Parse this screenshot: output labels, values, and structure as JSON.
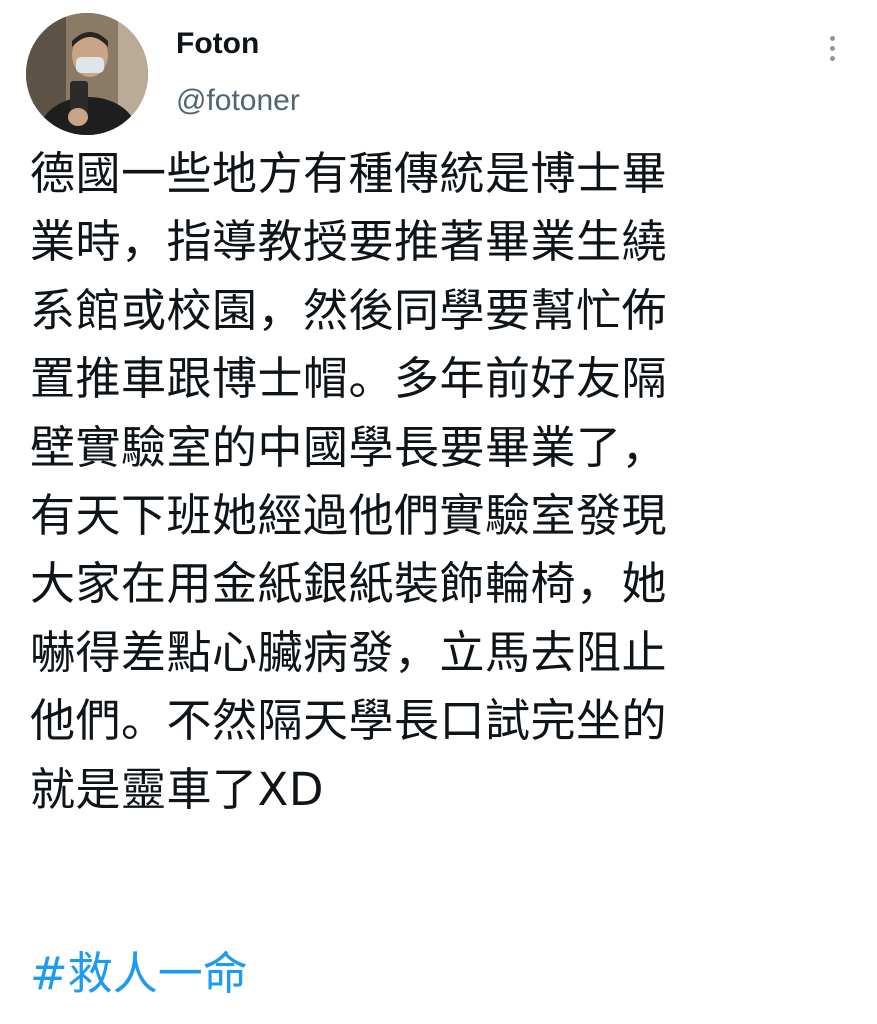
{
  "user": {
    "display_name": "Foton",
    "handle": "@fotoner"
  },
  "icons": {
    "avatar": "avatar-photo",
    "more": "more-vertical-icon"
  },
  "tweet": {
    "lines": [
      "德國一些地方有種傳統是博士畢",
      "業時，指導教授要推著畢業生繞",
      "系館或校園，然後同學要幫忙佈",
      "置推車跟博士帽。多年前好友隔",
      "壁實驗室的中國學長要畢業了，",
      "有天下班她經過他們實驗室發現",
      "大家在用金紙銀紙裝飾輪椅，她",
      "嚇得差點心臟病發，立馬去阻止",
      "他們。不然隔天學長口試完坐的",
      "就是靈車了XD"
    ],
    "hashtag": "#救人一命"
  },
  "colors": {
    "text": "#0f1419",
    "secondary": "#536471",
    "link": "#1d9bf0"
  }
}
